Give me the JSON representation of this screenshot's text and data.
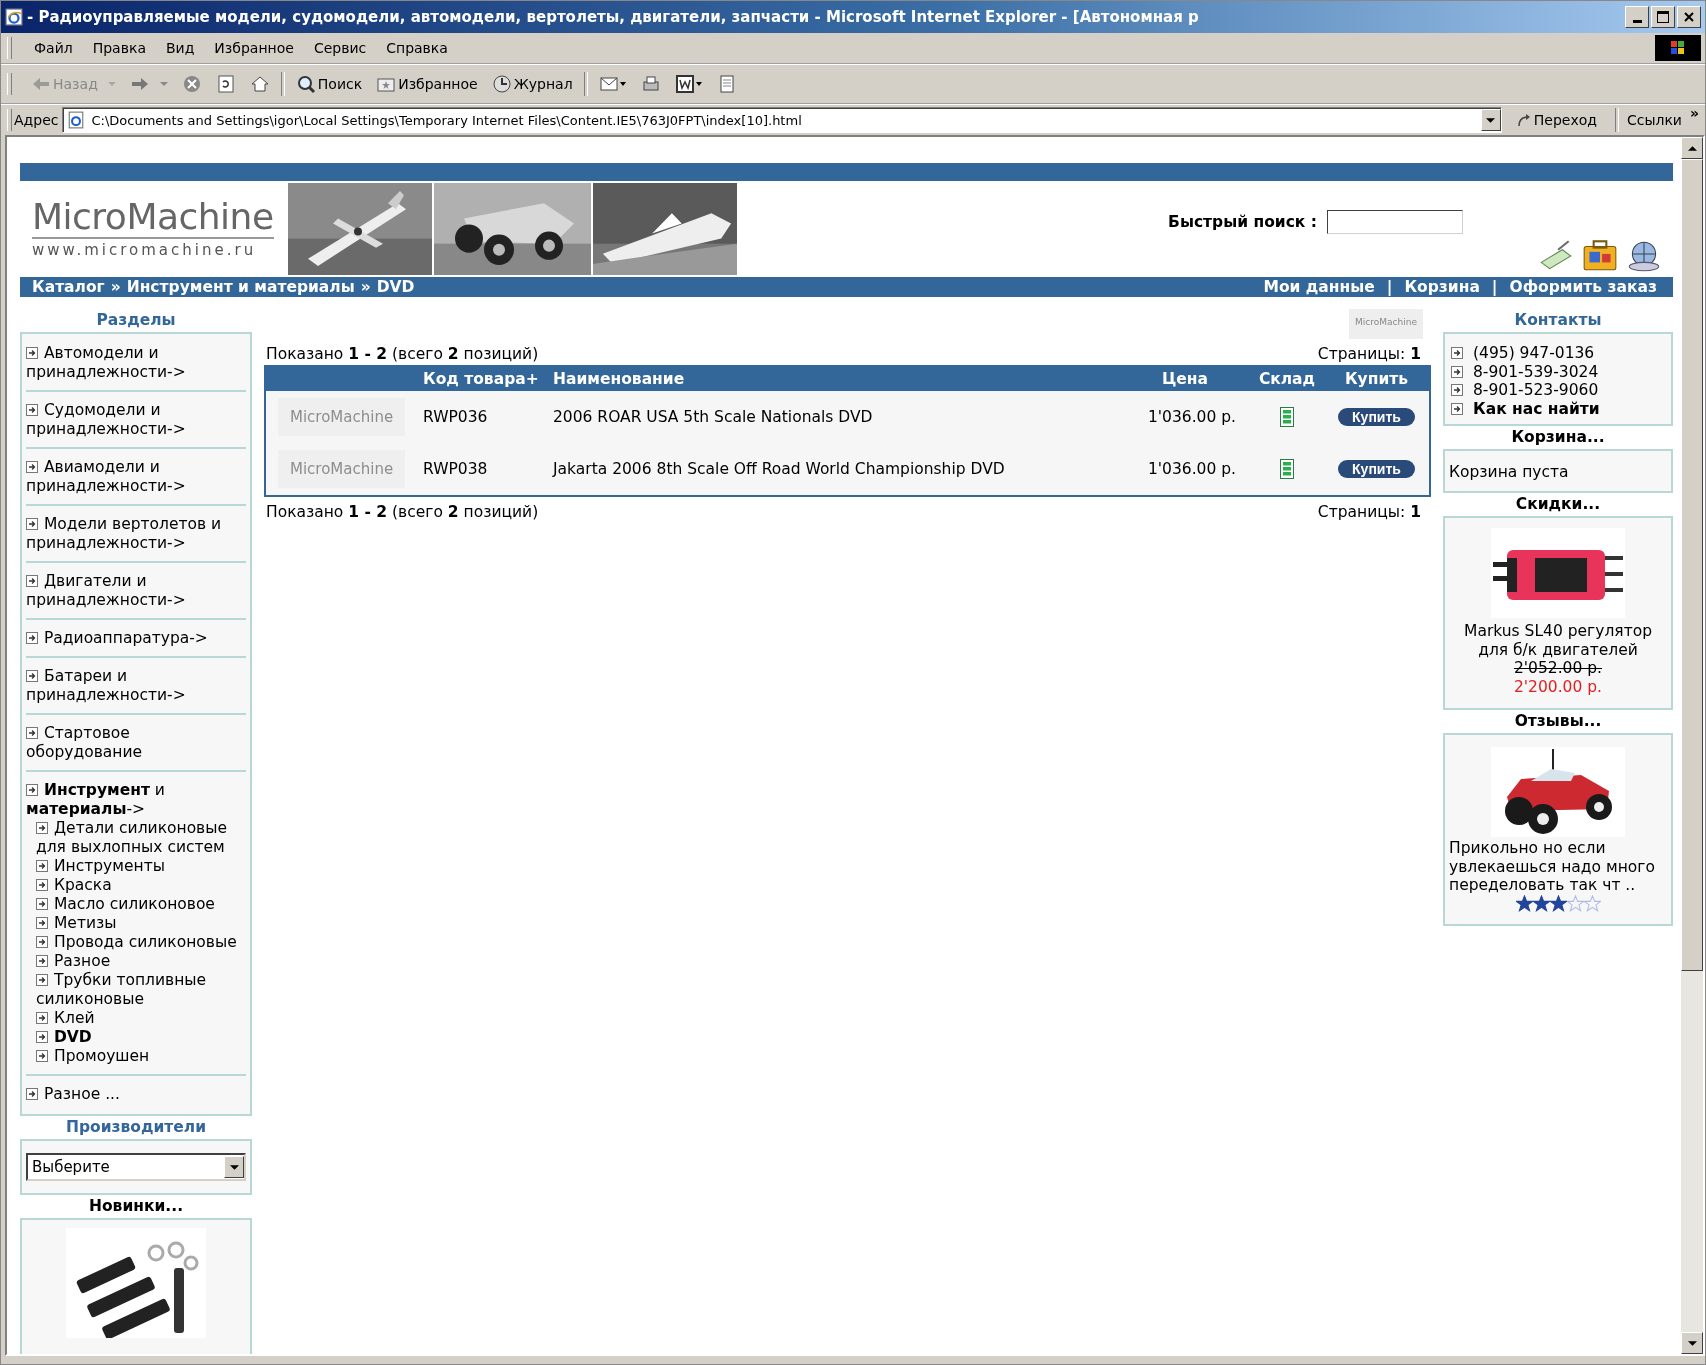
{
  "window": {
    "title": "- Радиоуправляемые модели, судомодели, автомодели, вертолеты, двигатели, запчасти - Microsoft Internet Explorer - [Автономная р"
  },
  "menu": [
    "Файл",
    "Правка",
    "Вид",
    "Избранное",
    "Сервис",
    "Справка"
  ],
  "toolbar": [
    {
      "kind": "back",
      "label": "Назад",
      "disabled": true
    },
    {
      "kind": "forward",
      "disabled": false
    },
    {
      "kind": "stop",
      "disabled": false
    },
    {
      "kind": "refresh",
      "disabled": false
    },
    {
      "kind": "home",
      "disabled": false
    },
    {
      "kind": "search",
      "label": "Поиск",
      "disabled": false
    },
    {
      "kind": "favorites",
      "label": "Избранное",
      "disabled": false
    },
    {
      "kind": "history",
      "label": "Журнал",
      "disabled": false
    },
    {
      "kind": "mail",
      "disabled": false
    },
    {
      "kind": "print",
      "disabled": false
    },
    {
      "kind": "edit",
      "disabled": false
    },
    {
      "kind": "discuss",
      "disabled": false
    }
  ],
  "address": {
    "label": "Адрес",
    "value": "C:\\Documents and Settings\\igor\\Local Settings\\Temporary Internet Files\\Content.IE5\\763J0FPT\\index[10].html",
    "go": "Переход",
    "links": "Ссылки",
    "more": "»"
  },
  "header": {
    "logo": "MicroMachine",
    "logo_url": "www.micromachine.ru",
    "search_label": "Быстрый поиск :"
  },
  "breadcrumb": [
    {
      "kind": "link",
      "label": "Каталог"
    },
    {
      "kind": "sep",
      "label": "»"
    },
    {
      "kind": "link",
      "label": "Инструмент и материалы"
    },
    {
      "kind": "sep",
      "label": "»"
    },
    {
      "kind": "link",
      "label": "DVD"
    }
  ],
  "nav_links": [
    {
      "kind": "link",
      "label": "Мои данные"
    },
    {
      "kind": "sep",
      "label": "|"
    },
    {
      "kind": "link",
      "label": "Корзина"
    },
    {
      "kind": "sep",
      "label": "|"
    },
    {
      "kind": "link",
      "label": "Оформить заказ"
    }
  ],
  "sections": {
    "title": "Разделы",
    "items": [
      {
        "label": "Автомодели и принадлежности->"
      },
      {
        "label": "Судомодели и принадлежности->"
      },
      {
        "label": "Авиамодели и принадлежности->"
      },
      {
        "label": "Модели вертолетов и принадлежности->"
      },
      {
        "label": "Двигатели и принадлежности->"
      },
      {
        "label": "Радиоаппаратура->"
      },
      {
        "label": "Батареи и принадлежности->"
      },
      {
        "label": "Стартовое оборудование"
      },
      {
        "label": "**Инструмент** и **материалы**->",
        "children": [
          {
            "label": "Детали силиконовые для выхлопных систем"
          },
          {
            "label": "Инструменты"
          },
          {
            "label": "Краска"
          },
          {
            "label": "Масло силиконовое"
          },
          {
            "label": "Метизы"
          },
          {
            "label": "Провода силиконовые"
          },
          {
            "label": "Разное"
          },
          {
            "label": "Трубки топливные силиконовые"
          },
          {
            "label": "Клей"
          },
          {
            "label": "**DVD**"
          },
          {
            "label": "Промоушен"
          }
        ]
      },
      {
        "label": "Разное ..."
      }
    ]
  },
  "manufacturers": {
    "title": "Производители",
    "value": "Выберите"
  },
  "new_items": {
    "title": "Новинки..."
  },
  "listing": {
    "summary_top": "Показано **1 - 2** (всего **2** позиций)",
    "pages_top": "Страницы: **1**",
    "summary_bottom": "Показано **1 - 2** (всего **2** позиций)",
    "pages_bottom": "Страницы: **1**",
    "banner": "MicroMachine",
    "columns": [
      "Код товара+",
      "Наименование",
      "Цена",
      "Склад",
      "Купить"
    ],
    "rows": [
      {
        "thumb": "MicroMachine",
        "code": "RWP036",
        "name": "2006 ROAR USA 5th Scale Nationals DVD",
        "price": "1'036.00 р.",
        "buy": "Купить"
      },
      {
        "thumb": "MicroMachine",
        "code": "RWP038",
        "name": "Jakarta 2006 8th Scale Off Road World Championship DVD",
        "price": "1'036.00 р.",
        "buy": "Купить"
      }
    ]
  },
  "contacts": {
    "title": "Контакты",
    "items": [
      {
        "kind": "text",
        "label": "(495) 947-0136"
      },
      {
        "kind": "text",
        "label": "8-901-539-3024"
      },
      {
        "kind": "text",
        "label": "8-901-523-9060"
      },
      {
        "kind": "link",
        "label": "Как нас найти"
      }
    ]
  },
  "cart": {
    "title": "Корзина...",
    "text": "Корзина пуста"
  },
  "discounts": {
    "title": "Скидки...",
    "name": "Markus SL40 регулятор для б/к двигателей",
    "old_price": "2'052.00 р.",
    "price": "2'200.00 р."
  },
  "reviews": {
    "title": "Отзывы...",
    "text": "Прикольно но если увлекаешься надо много переделовать так чт ..",
    "stars": 3
  }
}
